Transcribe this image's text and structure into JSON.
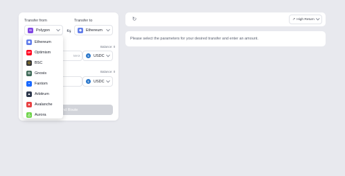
{
  "transfer": {
    "from_label": "Transfer from",
    "to_label": "Transfer to",
    "from_chain": "Polygon",
    "to_chain": "Ethereum",
    "balance_1": "Balance: 0",
    "balance_2": "Balance: 0",
    "max_label": "MAX",
    "token_1": "USDC",
    "token_2": "USDC",
    "submit_label": "Find Route"
  },
  "dropdown": {
    "items": [
      {
        "label": "Ethereum",
        "color": "#627eea",
        "icon": "ethereum-icon"
      },
      {
        "label": "Optimism",
        "color": "#ff0420",
        "icon": "optimism-icon"
      },
      {
        "label": "BSC",
        "color": "#3a3a3a",
        "icon": "bsc-icon"
      },
      {
        "label": "Gnosis",
        "color": "#3e6957",
        "icon": "gnosis-icon"
      },
      {
        "label": "Fantom",
        "color": "#1969ff",
        "icon": "fantom-icon"
      },
      {
        "label": "Arbitrum",
        "color": "#2d374b",
        "icon": "arbitrum-icon"
      },
      {
        "label": "Avalanche",
        "color": "#e84142",
        "icon": "avalanche-icon"
      },
      {
        "label": "Aurora",
        "color": "#70d44b",
        "icon": "aurora-icon"
      }
    ]
  },
  "routes": {
    "sort_label": "High Return",
    "message": "Please select the parameters for your desired transfer and enter an amount."
  },
  "colors": {
    "polygon": "#8247e5",
    "ethereum": "#627eea",
    "usdc": "#2775ca"
  }
}
